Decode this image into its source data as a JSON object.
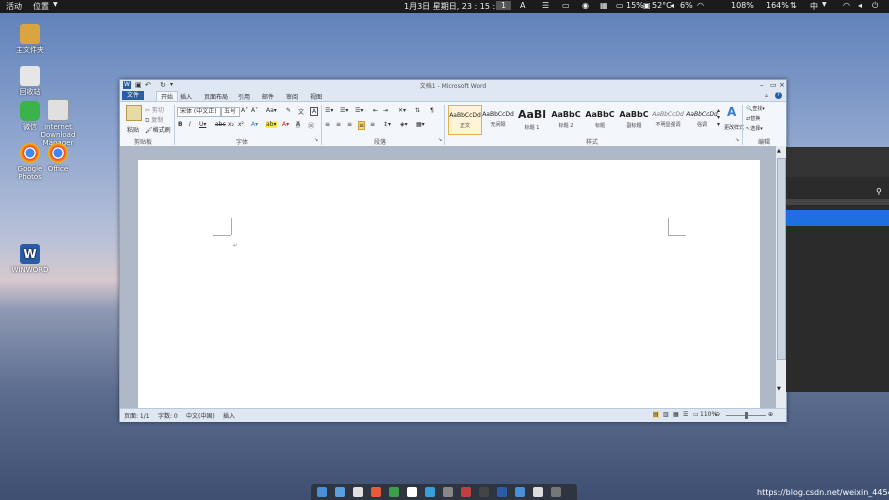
{
  "topbar": {
    "activities": "活动",
    "places": "位置",
    "clock": "1月3日 星期日, 23 : 15 : 08",
    "workspace": "1",
    "battery": "15%",
    "temp": "52°C",
    "volume": "6%",
    "net1": "108%",
    "net2": "164%",
    "lang": "中"
  },
  "desktop": {
    "icons": [
      {
        "label": "主文件夹",
        "icon": "home-folder-icon"
      },
      {
        "label": "回收站",
        "icon": "trash-icon"
      },
      {
        "label": "微信",
        "icon": "wechat-icon"
      },
      {
        "label": "Internet Download Manager",
        "icon": "idm-icon"
      },
      {
        "label": "Google Photos",
        "icon": "chrome-icon"
      },
      {
        "label": "Office",
        "icon": "chrome-icon"
      },
      {
        "label": "WINWORD",
        "icon": "word-icon"
      }
    ]
  },
  "word": {
    "title": "文档1 - Microsoft Word",
    "file_tab": "文件",
    "tabs": [
      "开始",
      "插入",
      "页面布局",
      "引用",
      "邮件",
      "审阅",
      "视图"
    ],
    "clipboard": {
      "paste": "粘贴",
      "cut": "剪切",
      "copy": "复制",
      "format_painter": "格式刷",
      "label": "剪贴板"
    },
    "font": {
      "name": "宋体 (中文正)",
      "size": "五号",
      "label": "字体"
    },
    "paragraph_label": "段落",
    "styles": [
      {
        "preview": "AaBbCcDd",
        "name": "正文"
      },
      {
        "preview": "AaBbCcDd",
        "name": "无间隔"
      },
      {
        "preview": "AaBl",
        "name": "标题 1"
      },
      {
        "preview": "AaBbC",
        "name": "标题 2"
      },
      {
        "preview": "AaBbC",
        "name": "标题"
      },
      {
        "preview": "AaBbC",
        "name": "副标题"
      },
      {
        "preview": "AaBbCcDd",
        "name": "不明显强调"
      },
      {
        "preview": "AaBbCcDd",
        "name": "强调"
      }
    ],
    "change_styles": "更改样式",
    "styles_label": "样式",
    "editing": {
      "find": "查找",
      "replace": "替换",
      "select": "选择",
      "label": "编辑"
    },
    "status": {
      "page": "页面: 1/1",
      "words": "字数: 0",
      "lang": "中文(中国)",
      "mode": "插入",
      "zoom": "110%"
    }
  },
  "dock_colors": [
    "#4a90d9",
    "#5aa0e0",
    "#e0e0e0",
    "#e85a3a",
    "#3aa04a",
    "#ffffff",
    "#3a9fd9",
    "#888888",
    "#c04040",
    "#444444",
    "#2a5ca8",
    "#4a90d9",
    "#dddddd",
    "#777777"
  ],
  "watermark": "https://blog.csdn.net/weixin_44543418"
}
